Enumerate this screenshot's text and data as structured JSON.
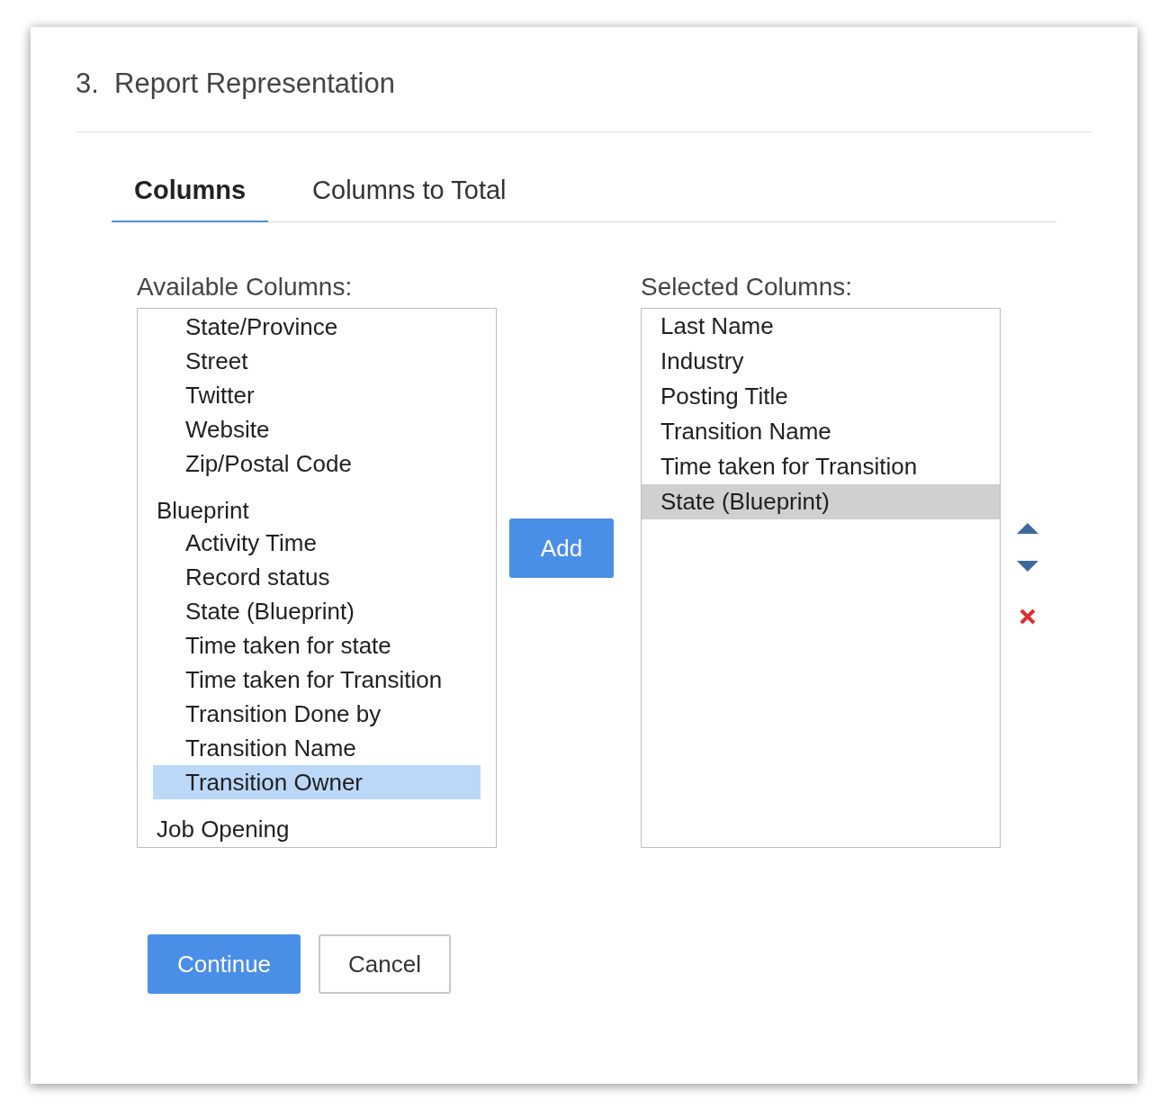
{
  "section_title": "3.  Report Representation",
  "tabs": [
    {
      "label": "Columns",
      "selected": true
    },
    {
      "label": "Columns to Total",
      "selected": false
    }
  ],
  "available_columns": {
    "label": "Available Columns:",
    "items": [
      {
        "kind": "field",
        "text": "State/Province",
        "selected": false
      },
      {
        "kind": "field",
        "text": "Street",
        "selected": false
      },
      {
        "kind": "field",
        "text": "Twitter",
        "selected": false
      },
      {
        "kind": "field",
        "text": "Website",
        "selected": false
      },
      {
        "kind": "field",
        "text": "Zip/Postal Code",
        "selected": false
      },
      {
        "kind": "group",
        "text": "Blueprint",
        "children": [
          {
            "text": "Activity Time",
            "selected": false
          },
          {
            "text": "Record status",
            "selected": false
          },
          {
            "text": "State (Blueprint)",
            "selected": false
          },
          {
            "text": "Time taken for state",
            "selected": false
          },
          {
            "text": "Time taken for Transition",
            "selected": false
          },
          {
            "text": "Transition Done by",
            "selected": false
          },
          {
            "text": "Transition Name",
            "selected": false
          },
          {
            "text": "Transition Owner",
            "selected": true
          }
        ]
      },
      {
        "kind": "group",
        "text": "Job Opening"
      }
    ]
  },
  "add_button": "Add",
  "selected_columns": {
    "label": "Selected Columns:",
    "items": [
      {
        "text": "Last Name",
        "selected": false
      },
      {
        "text": "Industry",
        "selected": false
      },
      {
        "text": "Posting Title",
        "selected": false
      },
      {
        "text": "Transition Name",
        "selected": false
      },
      {
        "text": "Time taken for Transition",
        "selected": false
      },
      {
        "text": "State (Blueprint)",
        "selected": true
      }
    ]
  },
  "buttons": [
    {
      "kind": "primary",
      "label": "Continue"
    },
    {
      "kind": "secondary",
      "label": "Cancel"
    }
  ]
}
